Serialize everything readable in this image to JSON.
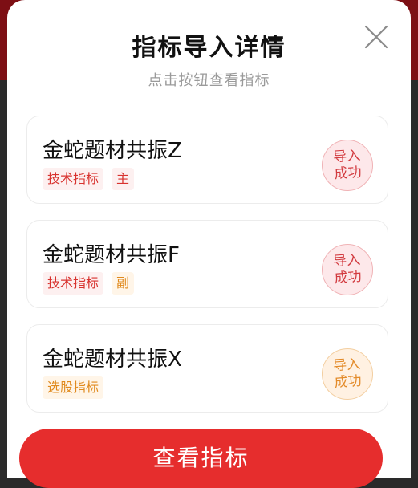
{
  "dialog": {
    "title": "指标导入详情",
    "subtitle": "点击按钮查看指标"
  },
  "items": [
    {
      "name": "金蛇题材共振Z",
      "tags": [
        "技术指标",
        "主"
      ],
      "status": [
        "导入",
        "成功"
      ],
      "status_color": "red"
    },
    {
      "name": "金蛇题材共振F",
      "tags": [
        "技术指标",
        "副"
      ],
      "status": [
        "导入",
        "成功"
      ],
      "status_color": "red"
    },
    {
      "name": "金蛇题材共振X",
      "tags": [
        "选股指标"
      ],
      "status": [
        "导入",
        "成功"
      ],
      "status_color": "orange"
    }
  ],
  "primary_button": {
    "label": "查看指标"
  },
  "colors": {
    "accent": "#e62d2d",
    "tag_red": "#d8322e",
    "tag_orange": "#e08a1e"
  },
  "icons": {
    "close": "close-icon"
  }
}
